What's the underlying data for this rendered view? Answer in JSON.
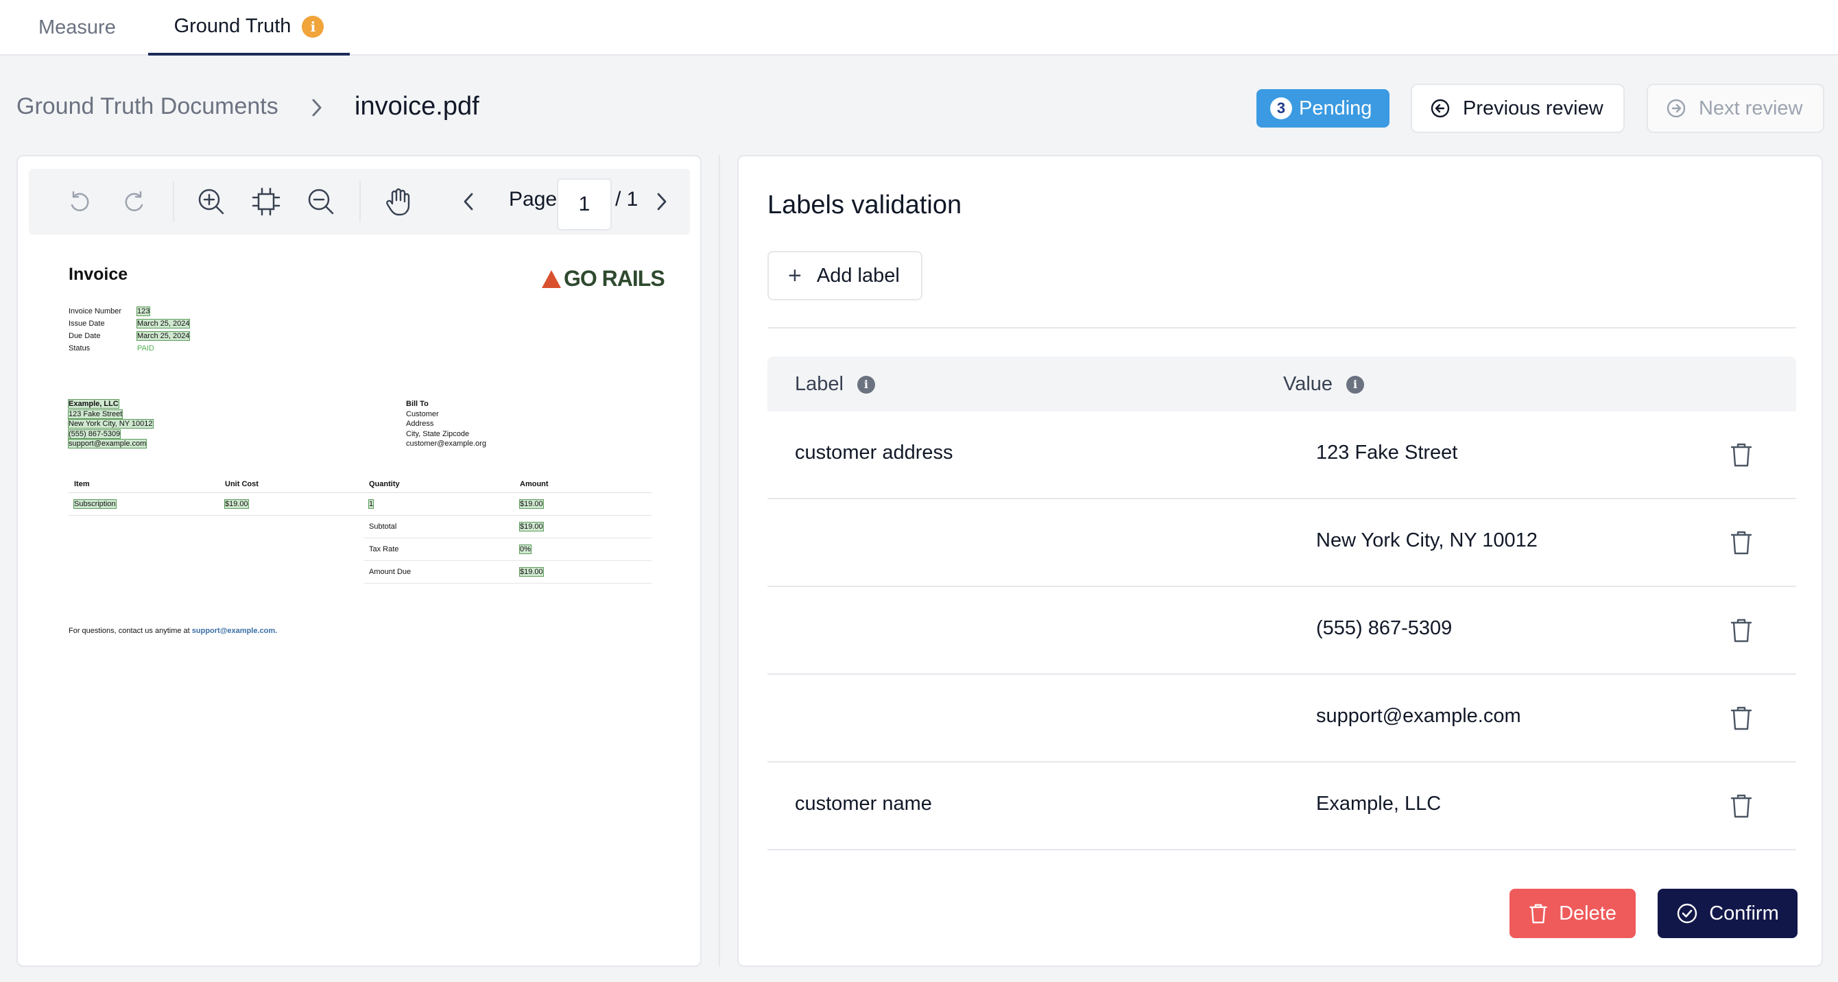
{
  "tabs": [
    {
      "label": "Measure"
    },
    {
      "label": "Ground Truth",
      "info_badge": "i"
    }
  ],
  "breadcrumb": {
    "root": "Ground Truth Documents",
    "current": "invoice.pdf"
  },
  "header": {
    "pending_count": "3",
    "pending_label": "Pending",
    "prev_label": "Previous review",
    "next_label": "Next review"
  },
  "viewer": {
    "page_label": "Page",
    "page_value": "1",
    "page_total": "/ 1"
  },
  "invoice": {
    "title": "Invoice",
    "logo": "GO RAILS",
    "meta": [
      {
        "key": "Invoice Number",
        "value": "123"
      },
      {
        "key": "Issue Date",
        "value": "March 25, 2024"
      },
      {
        "key": "Due Date",
        "value": "March 25, 2024"
      },
      {
        "key": "Status",
        "value": "PAID"
      }
    ],
    "from": [
      "Example, LLC",
      "123 Fake Street",
      "New York City, NY 10012",
      "(555) 867-5309",
      "support@example.com"
    ],
    "bill_to_title": "Bill To",
    "bill_to": [
      "Customer",
      "Address",
      "City, State Zipcode",
      "customer@example.org"
    ],
    "table_headers": [
      "Item",
      "Unit Cost",
      "Quantity",
      "Amount"
    ],
    "rows": [
      [
        "Subscription",
        "$19.00",
        "1",
        "$19.00"
      ],
      [
        "",
        "",
        "Subtotal",
        "$19.00"
      ],
      [
        "",
        "",
        "Tax Rate",
        "0%"
      ],
      [
        "",
        "",
        "Amount Due",
        "$19.00"
      ]
    ],
    "footer_text": "For questions, contact us anytime at ",
    "footer_link": "support@example.com."
  },
  "labels_panel": {
    "title": "Labels validation",
    "add_label": "Add label",
    "col_label": "Label",
    "col_value": "Value",
    "rows": [
      {
        "label": "customer address",
        "value": "123 Fake Street"
      },
      {
        "label": "",
        "value": "New York City, NY 10012"
      },
      {
        "label": "",
        "value": "(555) 867-5309"
      },
      {
        "label": "",
        "value": "support@example.com"
      },
      {
        "label": "customer name",
        "value": "Example, LLC"
      }
    ],
    "delete_label": "Delete",
    "confirm_label": "Confirm"
  },
  "colors": {
    "accent_navy": "#12174a",
    "pending_blue": "#3b9ae1",
    "danger_red": "#ef5b5b",
    "info_orange": "#f0a43a"
  },
  "icons": [
    "info-icon",
    "chevron-right-icon",
    "arrow-left-circle-icon",
    "arrow-right-circle-icon",
    "undo-icon",
    "redo-icon",
    "zoom-in-icon",
    "fit-page-icon",
    "zoom-out-icon",
    "hand-icon",
    "chevron-left-icon",
    "plus-icon",
    "trash-icon",
    "check-circle-icon"
  ]
}
